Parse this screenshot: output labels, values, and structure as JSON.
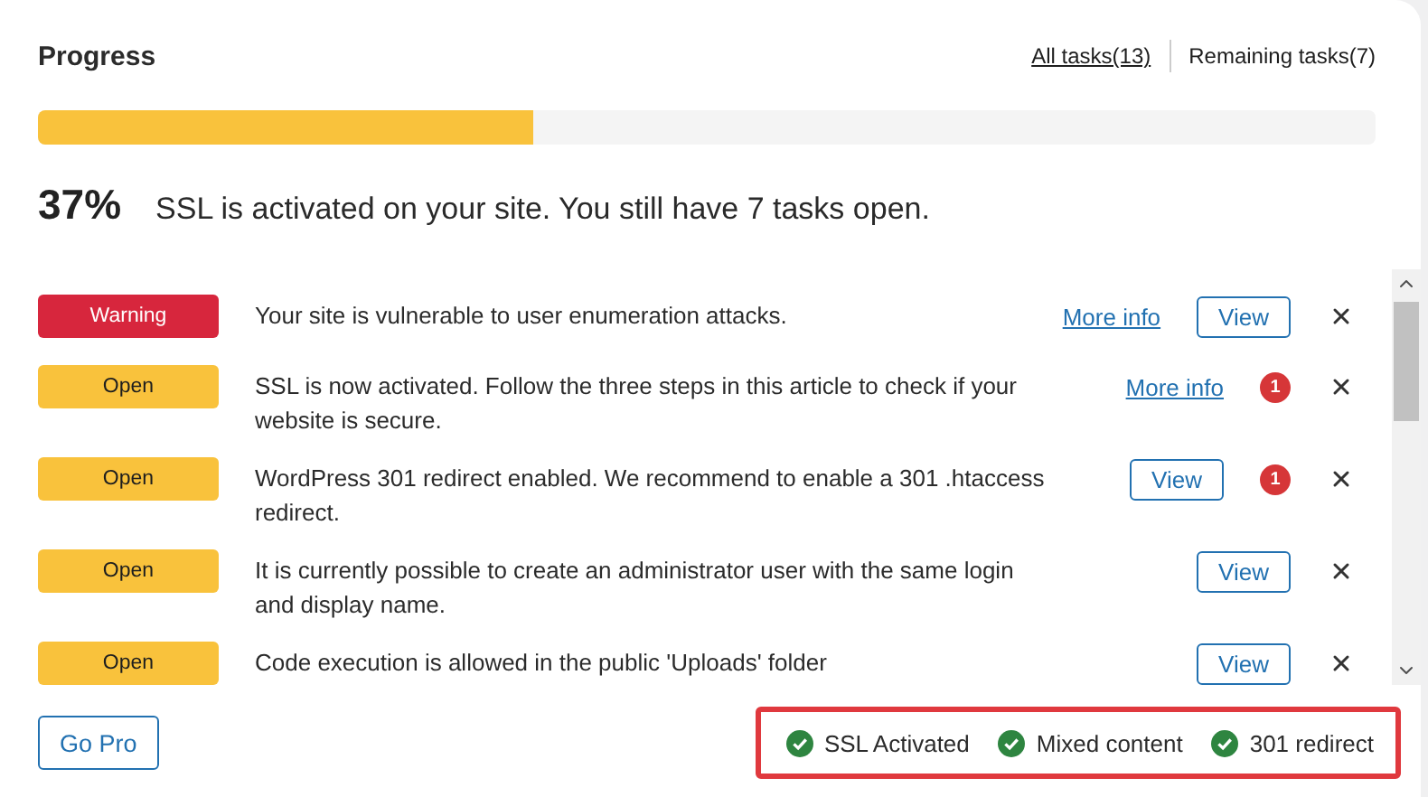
{
  "header": {
    "title": "Progress",
    "links": [
      {
        "label": "All tasks(13)",
        "selected": true
      },
      {
        "label": "Remaining tasks(7)",
        "selected": false
      }
    ]
  },
  "progress": {
    "level": 0.37,
    "percent": "37%",
    "message": "SSL is activated on your site. You still have 7 tasks open."
  },
  "tasks": [
    {
      "status": {
        "kind": "warning",
        "label": "Warning"
      },
      "text": "Your site is vulnerable to user enumeration attacks.",
      "more_info": "More info",
      "button": "View"
    },
    {
      "status": {
        "kind": "open",
        "label": "Open"
      },
      "text": "SSL is now activated. Follow the three steps in this article to check if your website is secure.",
      "more_info": "More info",
      "notice": "1"
    },
    {
      "status": {
        "kind": "open",
        "label": "Open"
      },
      "text": "WordPress 301 redirect enabled. We recommend to enable a 301 .htaccess redirect.",
      "button": "View",
      "notice": "1"
    },
    {
      "status": {
        "kind": "open",
        "label": "Open"
      },
      "text": "It is currently possible to create an administrator user with the same login and display name.",
      "button": "View"
    },
    {
      "status": {
        "kind": "open",
        "label": "Open"
      },
      "text": "Code execution is allowed in the public 'Uploads' folder",
      "button": "View"
    }
  ],
  "footer": {
    "button": "Go Pro",
    "checks": [
      "SSL Activated",
      "Mixed content",
      "301 redirect"
    ]
  }
}
